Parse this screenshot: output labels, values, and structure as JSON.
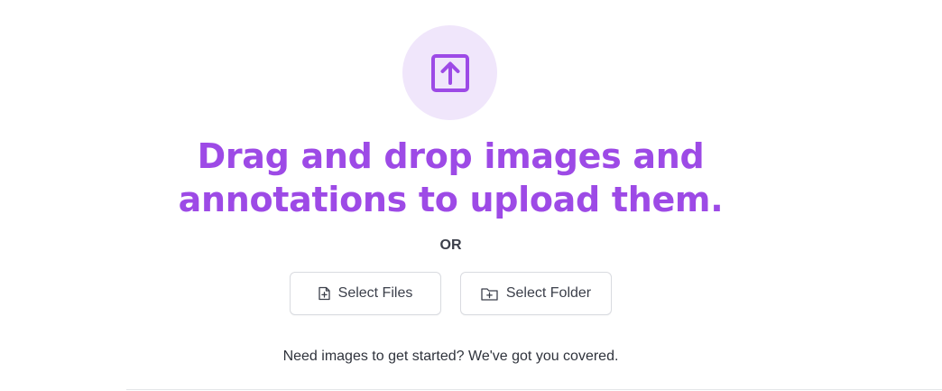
{
  "upload": {
    "icon": "upload-arrow-icon",
    "headline_line1": "Drag and drop images and",
    "headline_line2": "annotations to upload them.",
    "or_label": "OR"
  },
  "actions": {
    "select_files_label": "Select Files",
    "select_files_icon": "file-plus-icon",
    "select_folder_label": "Select Folder",
    "select_folder_icon": "folder-plus-icon"
  },
  "footer": {
    "need_images_text": "Need images to get started? We've got you covered."
  },
  "colors": {
    "accent": "#9d4ae6",
    "accent_light": "#f0e6fb",
    "text": "#3b3f4a"
  }
}
